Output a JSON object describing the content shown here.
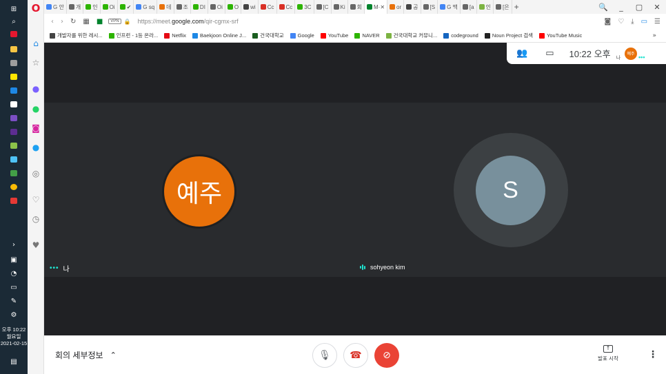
{
  "taskbar": {
    "clock_time": "오후 10:22",
    "clock_day": "월요일",
    "clock_date": "2021-02-15"
  },
  "tabs": [
    {
      "label": "G 안",
      "color": "#4285f4"
    },
    {
      "label": "개",
      "color": "#666666"
    },
    {
      "label": "인",
      "color": "#2db400"
    },
    {
      "label": "Oi",
      "color": "#2db400"
    },
    {
      "label": "✔",
      "color": "#2db400"
    },
    {
      "label": "G sq",
      "color": "#4285f4"
    },
    {
      "label": "데",
      "color": "#e8710a"
    },
    {
      "label": "조",
      "color": "#666666"
    },
    {
      "label": "DI",
      "color": "#2db400"
    },
    {
      "label": "Oi",
      "color": "#666666"
    },
    {
      "label": "O",
      "color": "#2db400"
    },
    {
      "label": "wi",
      "color": "#444444"
    },
    {
      "label": "Cc",
      "color": "#d93025"
    },
    {
      "label": "Cc",
      "color": "#d93025"
    },
    {
      "label": "3C",
      "color": "#2db400"
    },
    {
      "label": "[C",
      "color": "#666666"
    },
    {
      "label": "Ki",
      "color": "#666666"
    },
    {
      "label": "회",
      "color": "#666666"
    },
    {
      "label": "M·",
      "color": "#00832d",
      "active": true
    },
    {
      "label": "or",
      "color": "#e8710a"
    },
    {
      "label": "공",
      "color": "#444444"
    },
    {
      "label": "[S",
      "color": "#666666"
    },
    {
      "label": "G 맥",
      "color": "#4285f4"
    },
    {
      "label": "[a",
      "color": "#666666"
    },
    {
      "label": "인",
      "color": "#7cb342"
    },
    {
      "label": "[은",
      "color": "#666666"
    }
  ],
  "window_controls": [
    "🔍",
    "_",
    "▢",
    "✕"
  ],
  "address": {
    "vpn_label": "VPN",
    "url_prefix": "https://meet.",
    "url_domain": "google.com",
    "url_path": "/qir-cgmx-srf"
  },
  "bookmarks": [
    {
      "label": "개발자를 위한 레시...",
      "color": "#444444"
    },
    {
      "label": "인프런 - 1등 온라...",
      "color": "#2db400"
    },
    {
      "label": "Netflix",
      "color": "#e50914"
    },
    {
      "label": "Baekjoon Online J...",
      "color": "#1e88e5"
    },
    {
      "label": "건국대학교",
      "color": "#1b5e20"
    },
    {
      "label": "Google",
      "color": "#4285f4"
    },
    {
      "label": "YouTube",
      "color": "#ff0000"
    },
    {
      "label": "NAVER",
      "color": "#2db400"
    },
    {
      "label": "건국대학교 커뮤니...",
      "color": "#7cb342"
    },
    {
      "label": "codeground",
      "color": "#1565c0"
    },
    {
      "label": "Noun Project 검색",
      "color": "#222222"
    },
    {
      "label": "YouTube Music",
      "color": "#ff0000"
    }
  ],
  "meet": {
    "self_avatar_text": "예주",
    "self_name": "나",
    "other_avatar_text": "S",
    "other_name": "sohyeon kim",
    "info_time": "10:22 오후",
    "info_me_label": "나",
    "info_avatar_text": "예주",
    "meeting_details_label": "회의 세부정보",
    "present_label": "발표 시작"
  },
  "colors": {
    "accent_orange": "#e8710a",
    "speaking_teal": "#1ee3cf",
    "end_call_red": "#ea4335"
  }
}
